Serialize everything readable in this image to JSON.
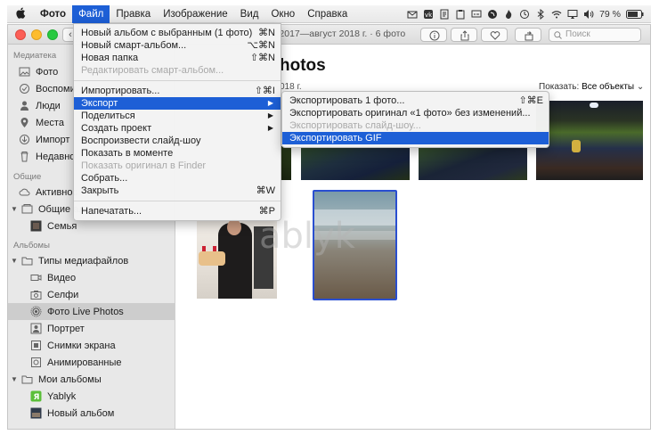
{
  "menubar": {
    "apple": "",
    "items": [
      "Фото",
      "Файл",
      "Правка",
      "Изображение",
      "Вид",
      "Окно",
      "Справка"
    ],
    "battery": "79 %"
  },
  "window": {
    "title": "ь 2017—август 2018 г. · 6 фото",
    "search_placeholder": "Поиск"
  },
  "sidebar": {
    "library_header": "Медиатека",
    "library_items": [
      "Фото",
      "Воспоми",
      "Люди",
      "Места",
      "Импорт",
      "Недавно"
    ],
    "shared_header": "Общие",
    "shared_items": [
      "Активнос",
      "Общие ал",
      "Семья"
    ],
    "albums_header": "Альбомы",
    "media_types": "Типы медиафайлов",
    "media_items": [
      "Видео",
      "Селфи",
      "Фото Live Photos",
      "Портрет",
      "Снимки экрана",
      "Анимированные"
    ],
    "my_albums": "Мои альбомы",
    "my_album_items": [
      "Yablyk",
      "Новый альбом"
    ]
  },
  "main": {
    "title": "hotos",
    "subtitle": "018 г.",
    "show_label": "Показать:",
    "show_value": "Все объекты",
    "watermark": "ablyk"
  },
  "file_menu": {
    "items": [
      {
        "label": "Новый альбом с выбранным (1 фото)",
        "shortcut": "⌘N"
      },
      {
        "label": "Новый смарт-альбом...",
        "shortcut": "⌥⌘N"
      },
      {
        "label": "Новая папка",
        "shortcut": "⇧⌘N"
      },
      {
        "label": "Редактировать смарт-альбом...",
        "shortcut": ""
      },
      {
        "label": "Импортировать...",
        "shortcut": "⇧⌘I"
      },
      {
        "label": "Экспорт",
        "shortcut": "▶"
      },
      {
        "label": "Поделиться",
        "shortcut": "▶"
      },
      {
        "label": "Создать проект",
        "shortcut": "▶"
      },
      {
        "label": "Воспроизвести слайд-шоу",
        "shortcut": ""
      },
      {
        "label": "Показать в моменте",
        "shortcut": ""
      },
      {
        "label": "Показать оригинал в Finder",
        "shortcut": ""
      },
      {
        "label": "Собрать...",
        "shortcut": ""
      },
      {
        "label": "Закрыть",
        "shortcut": "⌘W"
      },
      {
        "label": "Напечатать...",
        "shortcut": "⌘P"
      }
    ]
  },
  "export_menu": {
    "items": [
      {
        "label": "Экспортировать 1 фото...",
        "shortcut": "⇧⌘E"
      },
      {
        "label": "Экспортировать оригинал «1 фото» без изменений...",
        "shortcut": ""
      },
      {
        "label": "Экспортировать слайд-шоу...",
        "shortcut": ""
      },
      {
        "label": "Экспортировать GIF",
        "shortcut": ""
      }
    ]
  }
}
